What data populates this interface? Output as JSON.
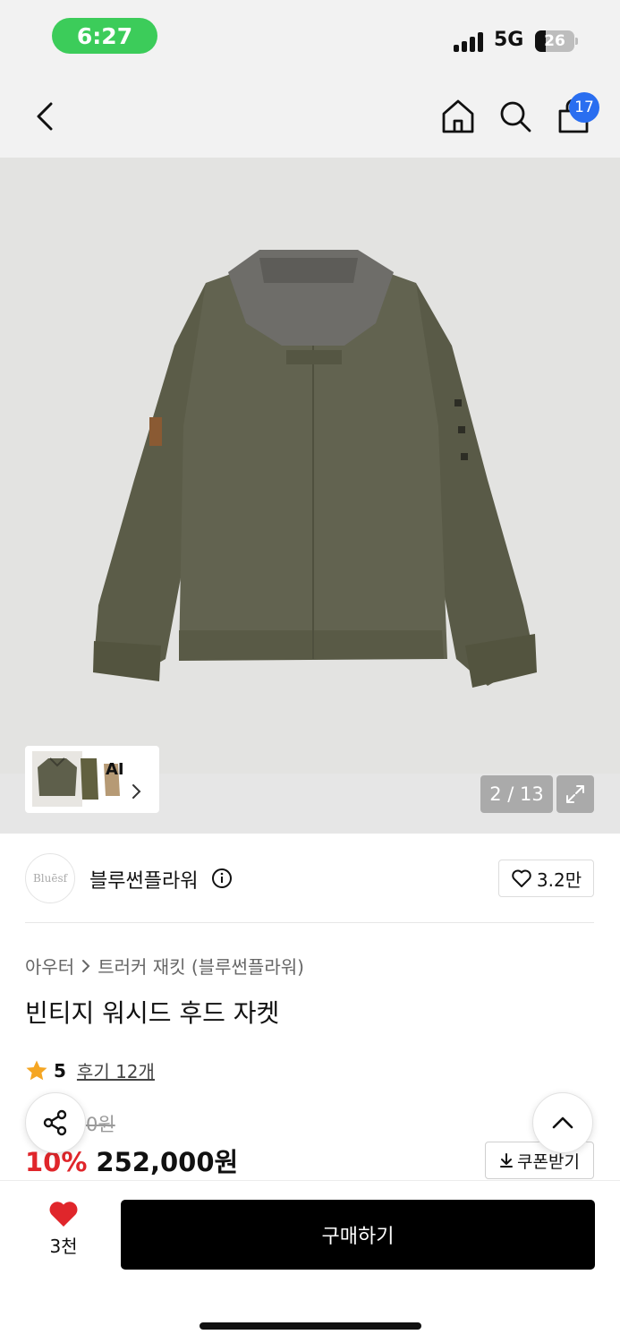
{
  "status_bar": {
    "time": "6:27",
    "network": "5G",
    "battery": "26"
  },
  "nav": {
    "back_icon": "chevron-left-icon",
    "home_icon": "home-icon",
    "search_icon": "search-icon",
    "cart_icon": "cart-icon",
    "cart_count": "17"
  },
  "gallery": {
    "ai_label": "AI",
    "counter": "2 / 13",
    "current_index": 2,
    "total_images": 13
  },
  "brand": {
    "logo_text": "Bluēsf",
    "name": "블루썬플라워",
    "likes": "3.2만"
  },
  "breadcrumb": {
    "category": "아우터",
    "subcategory": "트러커 재킷 (블루썬플라워)"
  },
  "product": {
    "title": "빈티지 워시드 후드 자켓",
    "rating": "5",
    "reviews_label": "후기 12개",
    "original_price_partial": "0원",
    "discount": "10%",
    "sale_price": "252,000원",
    "coupon_label": "쿠폰받기"
  },
  "bottom_bar": {
    "wish_count": "3천",
    "buy_label": "구매하기"
  },
  "colors": {
    "accent_red": "#e0262b",
    "badge_blue": "#2a6ef0",
    "status_green": "#3ccc5a",
    "star": "#f5a623",
    "jacket": "#5c5d4a"
  }
}
